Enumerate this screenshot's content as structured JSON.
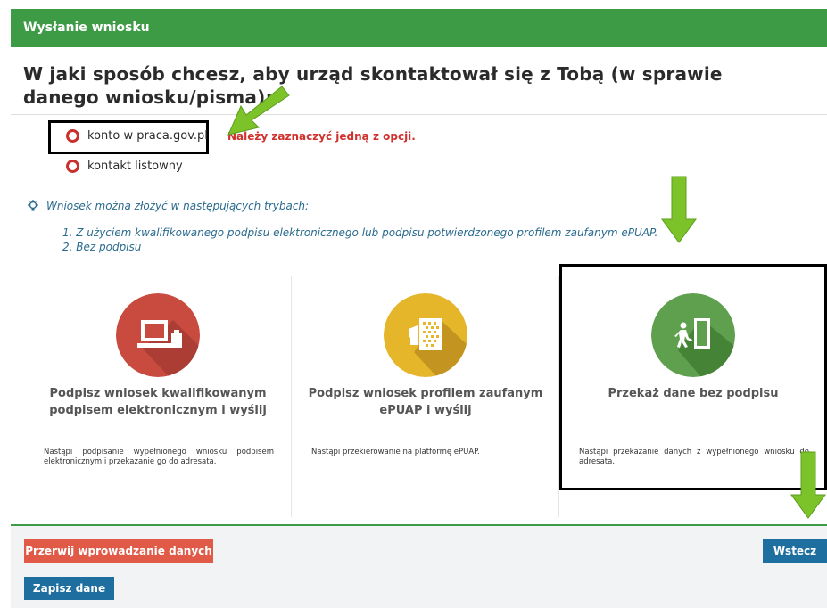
{
  "header": {
    "title": "Wysłanie wniosku"
  },
  "question": {
    "text": "W jaki sposób chcesz, aby urząd skontaktował się z Tobą (w sprawie danego wniosku/pisma):"
  },
  "contact_options": [
    {
      "label": "konto w praca.gov.pl"
    },
    {
      "label": "kontakt listowny"
    }
  ],
  "validation": {
    "message": "Należy zaznaczyć jedną z opcji."
  },
  "info": {
    "heading": "Wniosek można złożyć w następujących trybach:",
    "modes": [
      "1. Z użyciem kwalifikowanego podpisu elektronicznego lub podpisu potwierdzonego profilem zaufanym ePUAP.",
      "2. Bez podpisu"
    ]
  },
  "cards": [
    {
      "title": "Podpisz wniosek kwalifikowanym podpisem elektronicznym i wyślij",
      "description": "Nastąpi podpisanie wypełnionego wniosku podpisem elektronicznym i przekazanie go do adresata.",
      "icon": "computer-card-reader-icon",
      "color": "#c94a3f"
    },
    {
      "title": "Podpisz wniosek profilem zaufanym ePUAP i wyślij",
      "description": "Nastąpi przekierowanie na platformę ePUAP.",
      "icon": "epuap-profile-icon",
      "color": "#e5b52a"
    },
    {
      "title": "Przekaż dane bez podpisu",
      "description": "Nastąpi przekazanie danych z wypełnionego wniosku do adresata.",
      "icon": "person-door-icon",
      "color": "#5fa04e"
    }
  ],
  "buttons": {
    "cancel": "Przerwij wprowadzanie danych",
    "back": "Wstecz",
    "save": "Zapisz dane"
  },
  "colors": {
    "header_green": "#3d9b45",
    "error_red": "#d0312d",
    "radio_red": "#c8302c",
    "info_blue": "#2a6b8e",
    "button_blue": "#1e6f9f",
    "button_red": "#e05a47",
    "annotation_arrow": "#7cc32a"
  }
}
